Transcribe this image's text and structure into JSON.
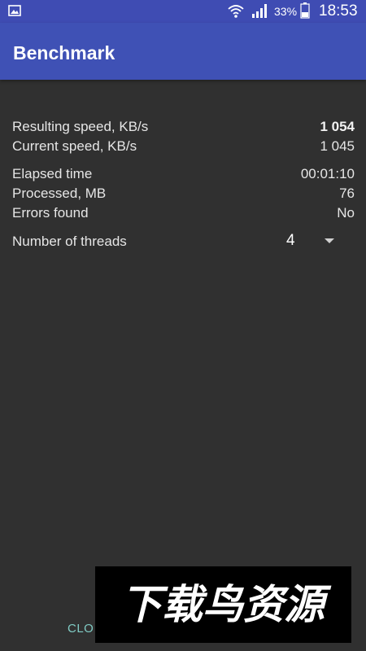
{
  "status_bar": {
    "battery_percent": "33%",
    "time": "18:53",
    "icons": [
      "gallery-icon",
      "wifi-icon",
      "signal-icon",
      "battery-icon"
    ]
  },
  "app_bar": {
    "title": "Benchmark"
  },
  "stats": [
    {
      "label": "Resulting speed, KB/s",
      "value": "1 054"
    },
    {
      "label": "Current speed, KB/s",
      "value": "1 045"
    },
    {
      "label": "Elapsed time",
      "value": "00:01:10"
    },
    {
      "label": "Processed, MB",
      "value": "76"
    },
    {
      "label": "Errors found",
      "value": "No"
    }
  ],
  "threads": {
    "label": "Number of threads",
    "selected": "4"
  },
  "actions": {
    "close_label": "CLO"
  },
  "watermark": {
    "text": "下载鸟资源"
  },
  "colors": {
    "status_bar": "#3f4cb3",
    "app_bar": "#3f51b5",
    "background": "#303030",
    "accent": "#80cbc4",
    "text": "#e6e6e6"
  }
}
